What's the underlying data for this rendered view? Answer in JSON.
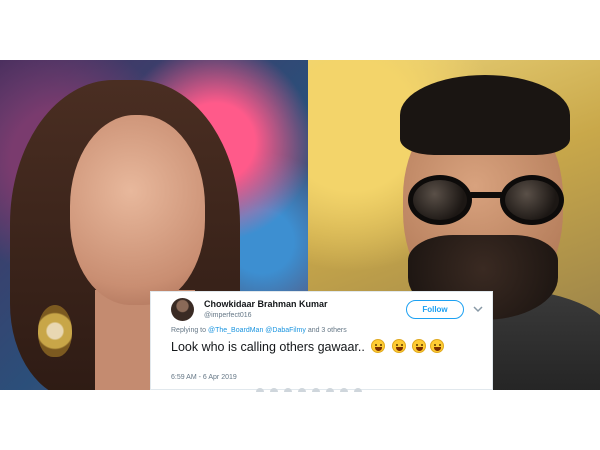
{
  "tweet": {
    "display_name": "Chowkidaar Brahman Kumar",
    "handle": "@imperfect016",
    "follow_label": "Follow",
    "replying_prefix": "Replying to",
    "mention_1": "@The_BoardMan",
    "mention_2": "@DabaFilmy",
    "replying_suffix": "and 3 others",
    "text": "Look who is calling others gawaar..",
    "emoji_count": 4,
    "emoji_name": "face-with-tears-of-joy",
    "timestamp": "6:59 AM - 6 Apr 2019"
  },
  "icons": {
    "follow_color": "#1da1f2",
    "chevron": "chevron-down-icon"
  },
  "colors": {
    "link": "#1b95e0",
    "text": "#14171a",
    "muted": "#657786"
  }
}
